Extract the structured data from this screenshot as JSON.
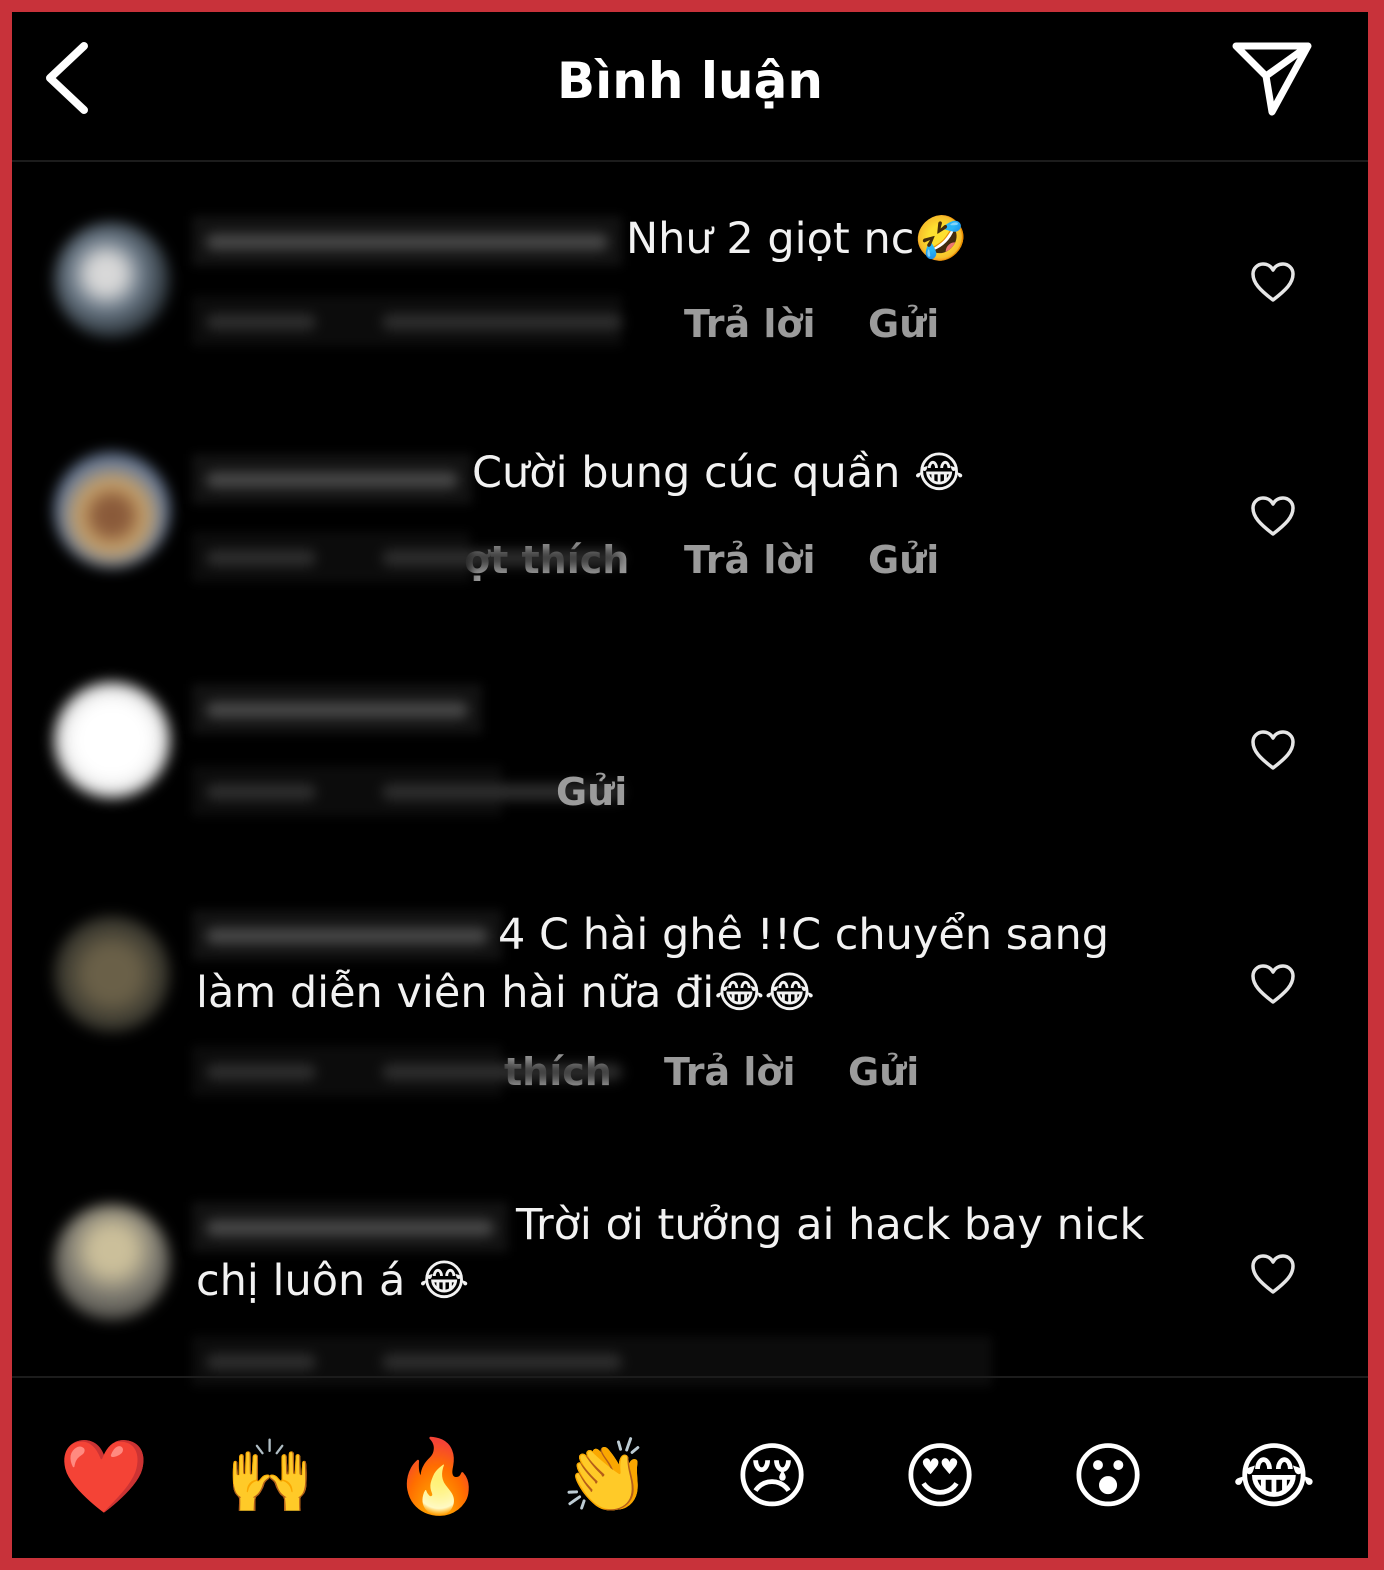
{
  "header": {
    "title": "Bình luận",
    "back_icon": "chevron-left-icon",
    "send_icon": "paper-plane-icon"
  },
  "comments": [
    {
      "text_line1": "Như 2 giọt nc🤣",
      "reply_label": "Trả lời",
      "send_label": "Gửi"
    },
    {
      "text_line1": "Cười bung cúc quần 😂",
      "likes_fragment": "ợt thích",
      "reply_label": "Trả lời",
      "send_label": "Gửi"
    },
    {
      "send_label": "Gửi"
    },
    {
      "text_line1": "4 C hài ghê !!C chuyển sang",
      "text_line2": "làm diễn viên hài nữa đi😂😂",
      "likes_fragment": "thích",
      "reply_label": "Trả lời",
      "send_label": "Gửi"
    },
    {
      "text_line1": "Trời ơi tưởng ai hack bay nick",
      "text_line2": "chị luôn á 😂"
    }
  ],
  "reactions": [
    "❤️",
    "🙌",
    "🔥",
    "👏",
    "😢",
    "😍",
    "😮",
    "😂"
  ],
  "colors": {
    "background": "#000000",
    "border": "#c8323a",
    "muted_text": "#9b9b9b"
  }
}
